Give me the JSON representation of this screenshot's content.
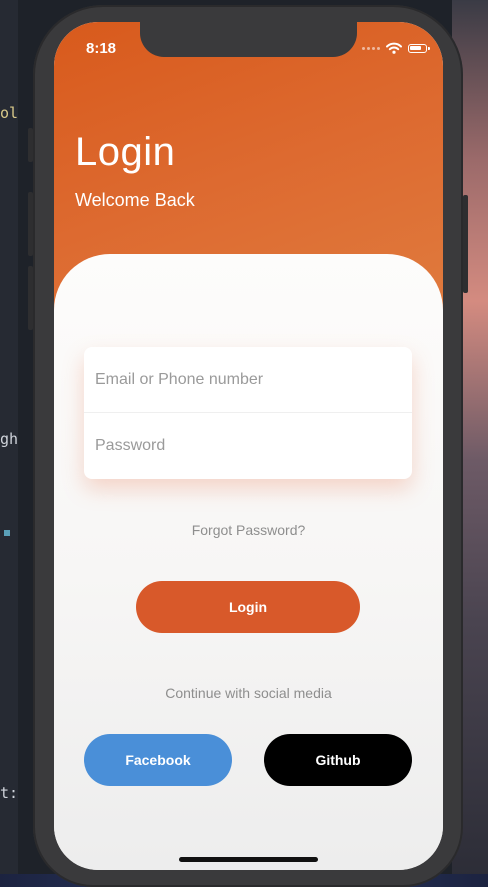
{
  "status_bar": {
    "time": "8:18"
  },
  "header": {
    "title": "Login",
    "subtitle": "Welcome Back"
  },
  "form": {
    "email_placeholder": "Email or Phone number",
    "password_placeholder": "Password"
  },
  "forgot_password": "Forgot Password?",
  "login_button": "Login",
  "social": {
    "prompt": "Continue with social media",
    "facebook_label": "Facebook",
    "github_label": "Github"
  },
  "editor": {
    "frag_top": "ol",
    "frag_mid": "gh",
    "frag_bot": "t:"
  },
  "colors": {
    "accent": "#d8592a",
    "facebook": "#4a8fd8",
    "github": "#000000"
  },
  "icons": [
    "wifi-icon",
    "battery-icon",
    "signal-icon"
  ]
}
